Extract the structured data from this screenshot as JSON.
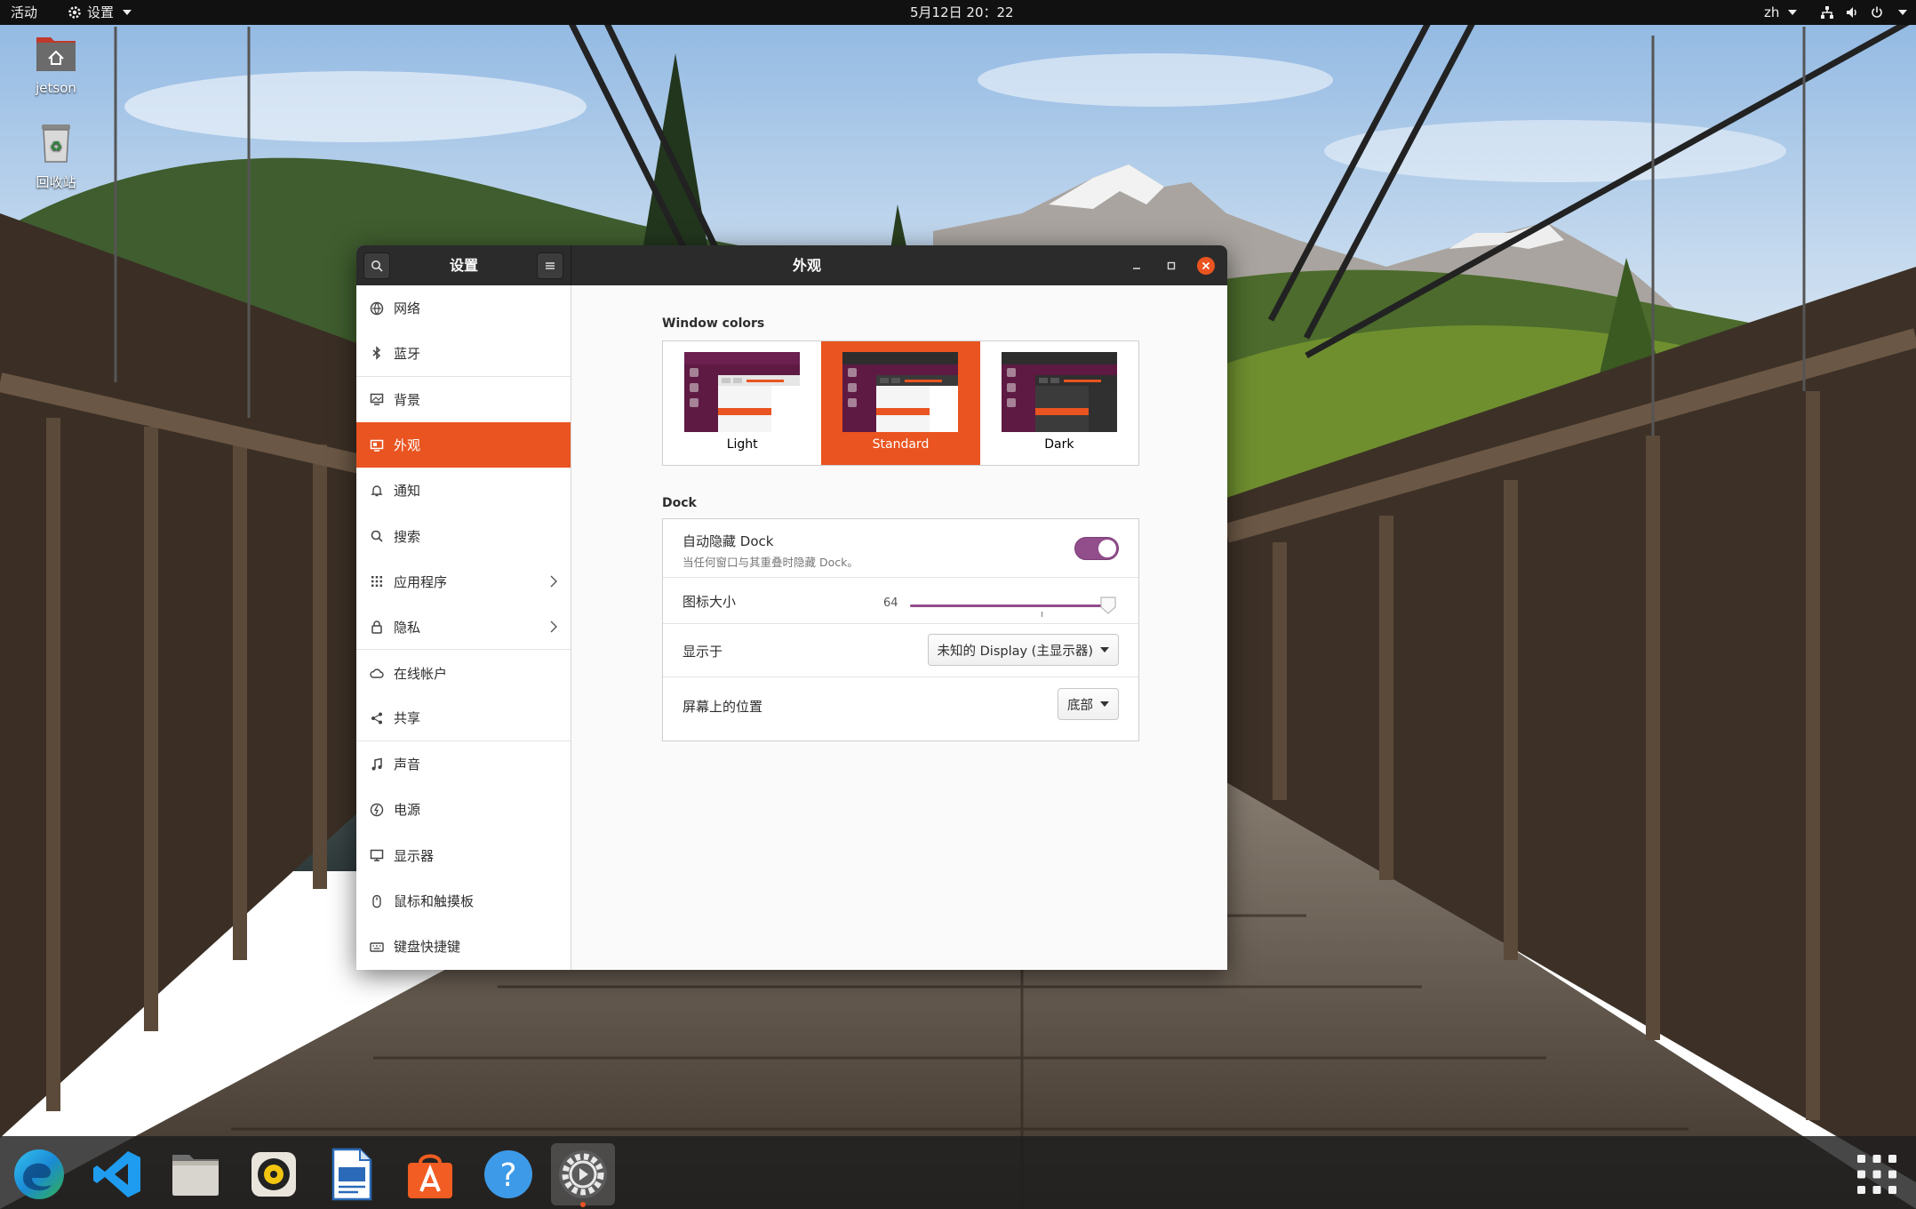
{
  "topbar": {
    "activities": "活动",
    "app_menu": "设置",
    "clock": "5月12日  20：22",
    "input_method": "zh"
  },
  "desktop": {
    "icons": [
      {
        "label": "jetson",
        "icon": "home-folder-icon"
      },
      {
        "label": "回收站",
        "icon": "trash-icon"
      }
    ]
  },
  "window": {
    "sidebar_title": "设置",
    "panel_title": "外观",
    "sidebar": {
      "items": [
        {
          "label": "网络",
          "icon": "network-icon"
        },
        {
          "label": "蓝牙",
          "icon": "bluetooth-icon"
        },
        {
          "label": "背景",
          "icon": "background-icon"
        },
        {
          "label": "外观",
          "icon": "appearance-icon",
          "active": true
        },
        {
          "label": "通知",
          "icon": "bell-icon"
        },
        {
          "label": "搜索",
          "icon": "search-icon"
        },
        {
          "label": "应用程序",
          "icon": "apps-grid-icon",
          "chevron": true
        },
        {
          "label": "隐私",
          "icon": "lock-icon",
          "chevron": true
        },
        {
          "label": "在线帐户",
          "icon": "cloud-icon"
        },
        {
          "label": "共享",
          "icon": "share-icon"
        },
        {
          "label": "声音",
          "icon": "music-note-icon"
        },
        {
          "label": "电源",
          "icon": "power-icon"
        },
        {
          "label": "显示器",
          "icon": "display-icon"
        },
        {
          "label": "鼠标和触摸板",
          "icon": "mouse-icon"
        },
        {
          "label": "键盘快捷键",
          "icon": "keyboard-icon"
        }
      ]
    },
    "appearance": {
      "window_colors_heading": "Window colors",
      "window_colors": [
        {
          "label": "Light"
        },
        {
          "label": "Standard",
          "selected": true
        },
        {
          "label": "Dark"
        }
      ],
      "dock_heading": "Dock",
      "dock": {
        "autohide_title": "自动隐藏 Dock",
        "autohide_subtitle": "当任何窗口与其重叠时隐藏 Dock。",
        "autohide_enabled": true,
        "icon_size_label": "图标大小",
        "icon_size_value": "64",
        "show_on_label": "显示于",
        "show_on_value": "未知的 Display (主显示器)",
        "position_label": "屏幕上的位置",
        "position_value": "底部"
      }
    }
  },
  "dock": {
    "apps": [
      {
        "icon": "edge-browser-icon"
      },
      {
        "icon": "vscode-icon"
      },
      {
        "icon": "files-icon"
      },
      {
        "icon": "rhythmbox-icon"
      },
      {
        "icon": "writer-icon"
      },
      {
        "icon": "software-center-icon"
      },
      {
        "icon": "help-icon"
      },
      {
        "icon": "settings-icon",
        "running": true
      }
    ],
    "show_apps_icon": "app-grid-icon"
  },
  "colors": {
    "accent": "#e95420",
    "toggle": "#924d8b",
    "titlebar": "#2b2b2b"
  }
}
